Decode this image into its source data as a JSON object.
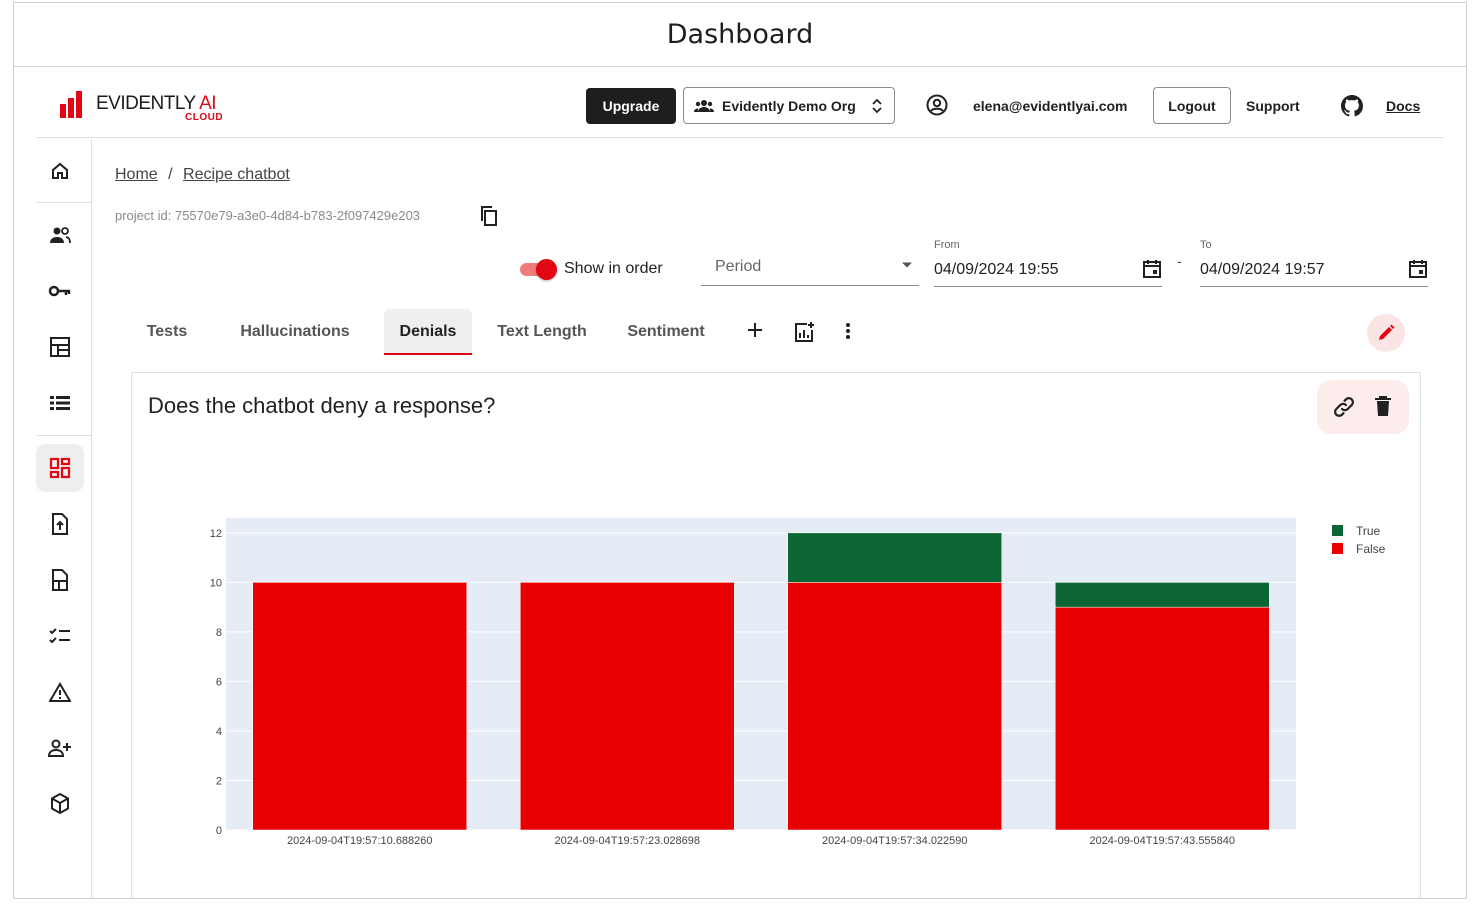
{
  "window": {
    "title": "Dashboard"
  },
  "header": {
    "logo_word": "EVIDENTLY",
    "logo_word_accent": "AI",
    "logo_sub": "CLOUD",
    "upgrade_label": "Upgrade",
    "org_name": "Evidently Demo Org",
    "email": "elena@evidentlyai.com",
    "logout_label": "Logout",
    "support_label": "Support",
    "docs_label": "Docs"
  },
  "sidebar": {
    "items": [
      {
        "icon": "home-icon"
      },
      {
        "icon": "users-icon"
      },
      {
        "icon": "key-icon"
      },
      {
        "icon": "layout-icon"
      },
      {
        "icon": "list-icon"
      },
      {
        "icon": "dashboard-icon",
        "active": true
      },
      {
        "icon": "upload-file-icon"
      },
      {
        "icon": "datasets-icon"
      },
      {
        "icon": "checklist-icon"
      },
      {
        "icon": "warning-icon"
      },
      {
        "icon": "add-user-icon"
      },
      {
        "icon": "package-icon"
      }
    ]
  },
  "breadcrumb": {
    "home": "Home",
    "separator": "/",
    "project": "Recipe chatbot"
  },
  "project_id": "project id: 75570e79-a3e0-4d84-b783-2f097429e203",
  "filters": {
    "show_in_order_label": "Show in order",
    "show_in_order": true,
    "period_placeholder": "Period",
    "from_label": "From",
    "from_value": "04/09/2024 19:55",
    "separator": "-",
    "to_label": "To",
    "to_value": "04/09/2024 19:57"
  },
  "tabs": [
    {
      "label": "Tests"
    },
    {
      "label": "Hallucinations"
    },
    {
      "label": "Denials",
      "active": true
    },
    {
      "label": "Text Length"
    },
    {
      "label": "Sentiment"
    }
  ],
  "panel": {
    "title": "Does the chatbot deny a response?"
  },
  "colors": {
    "accent": "#e30613",
    "true_series": "#0b6633",
    "false_series": "#e80000",
    "plot_bg": "#e5ecf6"
  },
  "chart_data": {
    "type": "bar",
    "stacked": true,
    "title": "",
    "xlabel": "",
    "ylabel": "",
    "categories": [
      "2024-09-04T19:57:10.688260",
      "2024-09-04T19:57:23.028698",
      "2024-09-04T19:57:34.022590",
      "2024-09-04T19:57:43.555840"
    ],
    "series": [
      {
        "name": "False",
        "color": "#e80000",
        "values": [
          10,
          10,
          10,
          9
        ]
      },
      {
        "name": "True",
        "color": "#0b6633",
        "values": [
          0,
          0,
          2,
          1
        ]
      }
    ],
    "yticks": [
      0,
      2,
      4,
      6,
      8,
      10,
      12
    ],
    "ylim": [
      0,
      12.6
    ],
    "legend_position": "top-right",
    "grid": true
  }
}
